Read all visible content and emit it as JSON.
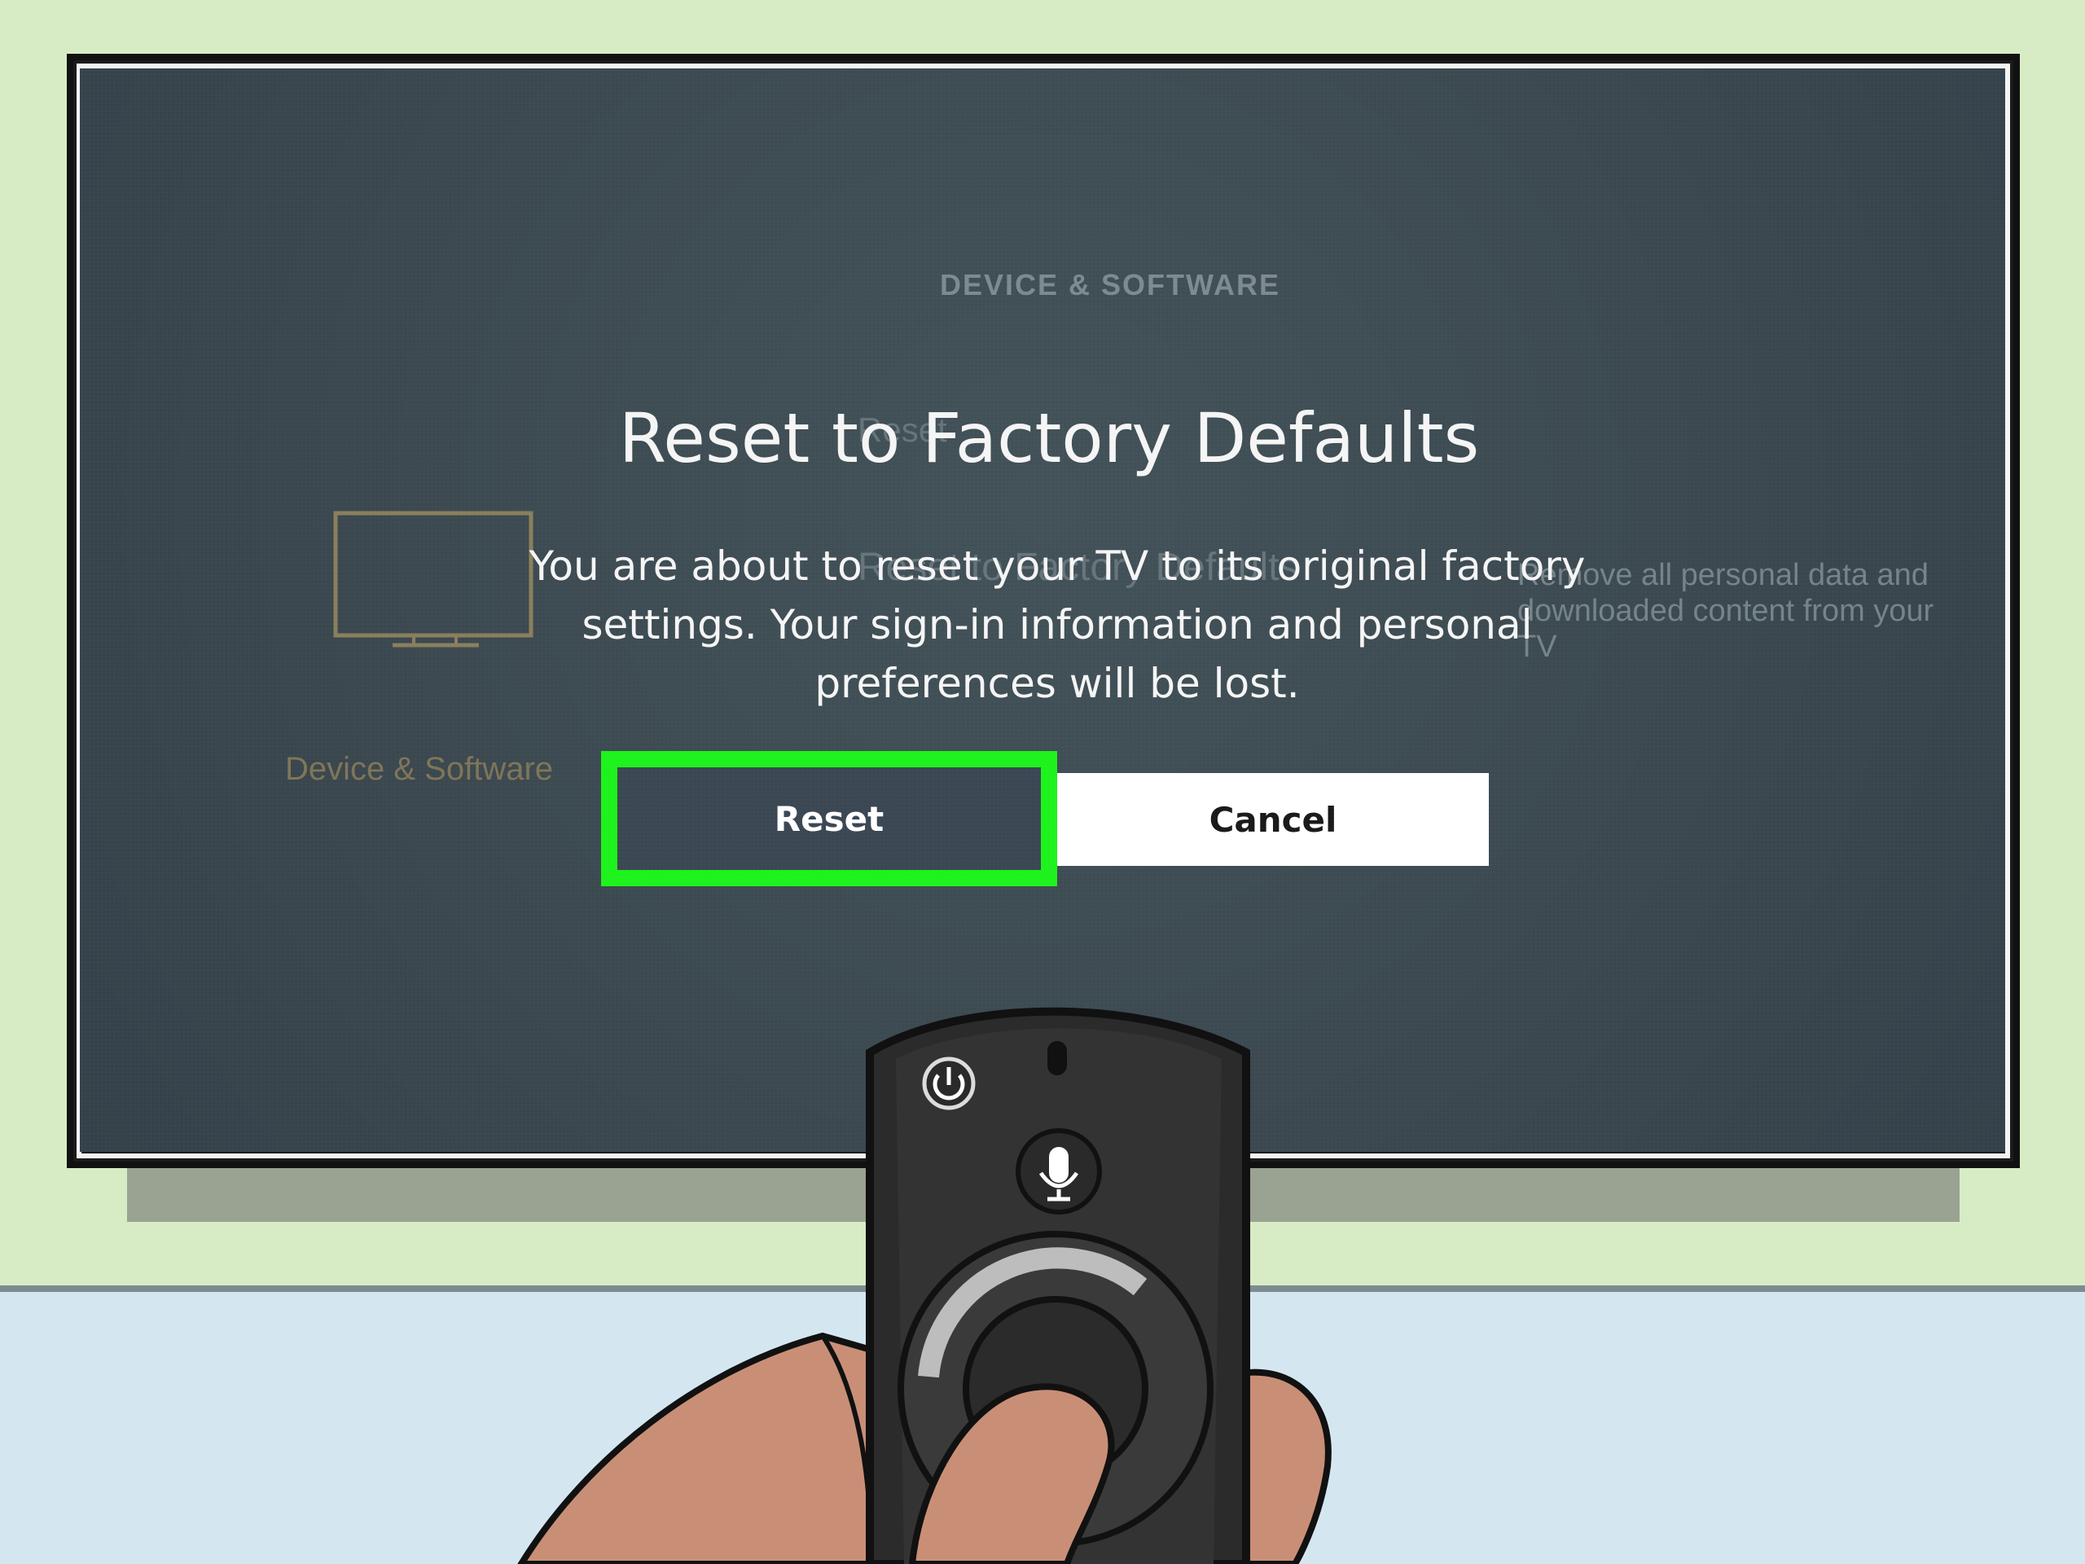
{
  "background_menu": {
    "section_title": "DEVICE & SOFTWARE",
    "reset_label": "Reset",
    "item_label": "Reset to Factory Defaults",
    "description": "Remove all personal data and downloaded content from your TV",
    "category_label": "Device & Software"
  },
  "dialog": {
    "title": "Reset to Factory Defaults",
    "message": "You are about to reset your TV to its original factory settings. Your sign-in information and personal preferences will be lost.",
    "reset_button": "Reset",
    "cancel_button": "Cancel"
  },
  "icons": {
    "tv": "tv-icon",
    "power": "power-icon",
    "microphone": "microphone-icon"
  },
  "colors": {
    "highlight": "#1ef21c",
    "screen": "#3b484f",
    "wall": "#d7ecc5",
    "floor": "#d4e7f1"
  }
}
